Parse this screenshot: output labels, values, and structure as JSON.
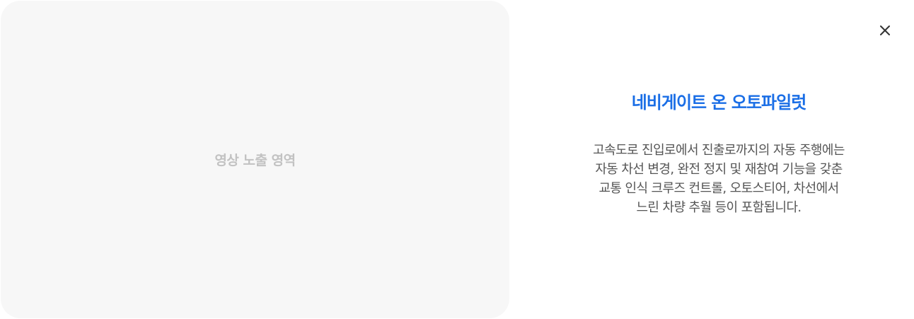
{
  "video": {
    "placeholder_label": "영상 노출 영역"
  },
  "close_button": {
    "icon": "close-icon"
  },
  "feature": {
    "title": "네비게이트 온 오토파일럿",
    "description_lines": [
      "고속도로 진입로에서 진출로까지의 자동 주행에는",
      "자동 차선 변경, 완전 정지 및 재참여 기능을 갖춘",
      "교통 인식 크루즈 컨트롤, 오토스티어, 차선에서",
      "느린 차량 추월 등이 포함됩니다."
    ]
  },
  "colors": {
    "title": "#1a6ee6",
    "text": "#555555",
    "video_bg": "#f7f7f7",
    "video_label": "#c2c2c2"
  }
}
